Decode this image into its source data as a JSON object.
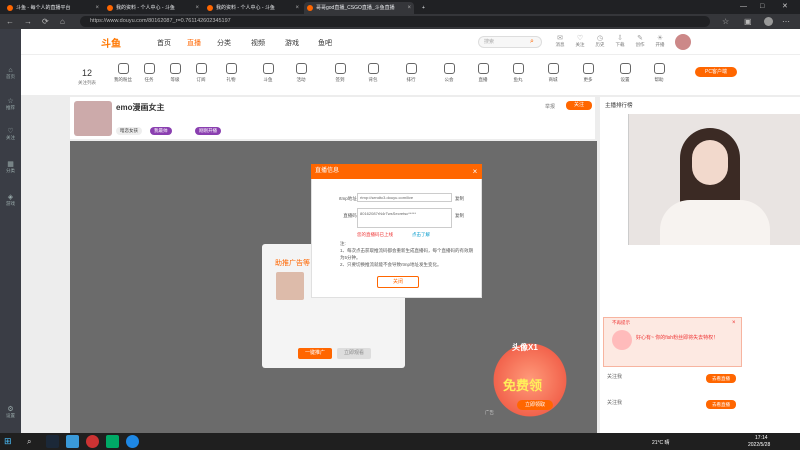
{
  "browser": {
    "tabs": [
      {
        "label": "斗鱼 - 每个人的直播平台"
      },
      {
        "label": "我的资料 - 个人中心 - 斗鱼"
      },
      {
        "label": "我的资料 - 个人中心 - 斗鱼"
      },
      {
        "label": "哥哥god直播_CSGO直播_斗鱼直播"
      }
    ],
    "new_tab": "+",
    "url": "https://www.douyu.com/80162087_r=0.761142602345197"
  },
  "header": {
    "logo": "斗鱼",
    "nav": [
      "首页",
      "直播",
      "分类",
      "视频",
      "游戏",
      "鱼吧"
    ],
    "nav_active_index": 1,
    "search_placeholder": "搜索",
    "icons": [
      "消息",
      "关注",
      "历史",
      "下载",
      "创作",
      "开播"
    ]
  },
  "leftbar": [
    "首页",
    "推荐",
    "关注",
    "分类",
    "游戏",
    "设置"
  ],
  "category_row": {
    "count": "12",
    "count_label": "关注列表",
    "items": [
      "我的粉丝",
      "任务",
      "等级",
      "订阅",
      "礼物",
      "斗鱼",
      "活动",
      "签到",
      "背包",
      "排行",
      "公会",
      "直播",
      "鱼丸",
      "商城",
      "更多",
      "设置",
      "帮助",
      "赛事",
      "频道",
      "更多"
    ],
    "badge": "PC客户端"
  },
  "room": {
    "name": "emo漫画女主",
    "tags": [
      "暗恋女孩",
      "我最帅",
      "刚刚开播"
    ],
    "report": "举报",
    "follow": "关注"
  },
  "dialog": {
    "title": "直播信息",
    "rtmp_label": "rtmp地址:",
    "rtmp_value": "rtmp://sendtc3.douyu.com/live",
    "copy1": "复制",
    "code_label": "直播码:",
    "code_value": "80162087rN4rTwsSecretsc*****",
    "copy2": "复制",
    "notice": "您的直播码已上线",
    "notice_link": "点击了解",
    "note_title": "注:",
    "notes": [
      "1、每次点击获取推流码都会重新生成直播码，每个直播码的有效期为5分钟。",
      "2、只要切换推流就能不会导致rtmp地址发生变化。"
    ],
    "close_btn": "关闭"
  },
  "gift_box": {
    "title": "助推广告等",
    "btn1": "一键推广",
    "btn2": "立即观看"
  },
  "promo": {
    "title": "免费领",
    "sub": "头像X1",
    "cta": "立即领取",
    "ad": "广告"
  },
  "right": {
    "title": "主播排行榜",
    "redpop_title": "不再提示",
    "redpop_text": "好心有~ 你的fish粉丝即将失去特权！",
    "items": [
      "关注我",
      "关注我"
    ],
    "btn": "去看直播"
  },
  "taskbar": {
    "weather": "21°C 晴",
    "time": "17:14",
    "date": "2022/5/28"
  }
}
